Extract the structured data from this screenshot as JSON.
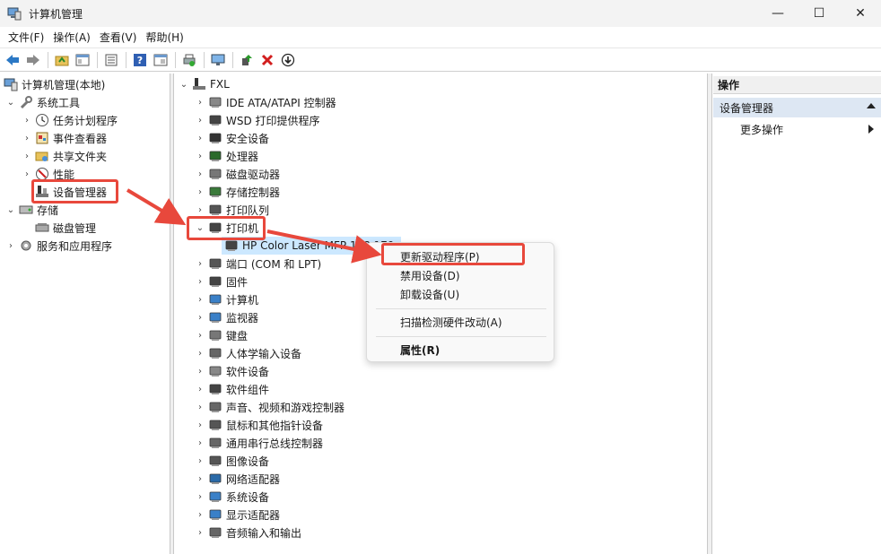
{
  "window": {
    "title": "计算机管理",
    "minimize": "—",
    "maximize": "☐",
    "close": "✕"
  },
  "menu": [
    "文件(F)",
    "操作(A)",
    "查看(V)",
    "帮助(H)"
  ],
  "left_tree": {
    "root": "计算机管理(本地)",
    "system_tools": "系统工具",
    "task_scheduler": "任务计划程序",
    "event_viewer": "事件查看器",
    "shared_folders": "共享文件夹",
    "performance": "性能",
    "device_manager": "设备管理器",
    "storage": "存储",
    "disk_management": "磁盘管理",
    "services_apps": "服务和应用程序"
  },
  "device_tree": {
    "root": "FXL",
    "categories": [
      "IDE ATA/ATAPI 控制器",
      "WSD 打印提供程序",
      "安全设备",
      "处理器",
      "磁盘驱动器",
      "存储控制器",
      "打印队列",
      "打印机",
      "HP Color Laser MFP 178 179",
      "端口 (COM 和 LPT)",
      "固件",
      "计算机",
      "监视器",
      "键盘",
      "人体学输入设备",
      "软件设备",
      "软件组件",
      "声音、视频和游戏控制器",
      "鼠标和其他指针设备",
      "通用串行总线控制器",
      "图像设备",
      "网络适配器",
      "系统设备",
      "显示适配器",
      "音频输入和输出"
    ]
  },
  "context_menu": {
    "update_driver": "更新驱动程序(P)",
    "disable_device": "禁用设备(D)",
    "uninstall_device": "卸载设备(U)",
    "scan_hardware": "扫描检测硬件改动(A)",
    "properties": "属性(R)"
  },
  "actions": {
    "header": "操作",
    "section": "设备管理器",
    "more": "更多操作"
  },
  "colors": {
    "highlight": "#e8483c",
    "selection": "#cce8ff",
    "accent": "#1e6fd9"
  }
}
